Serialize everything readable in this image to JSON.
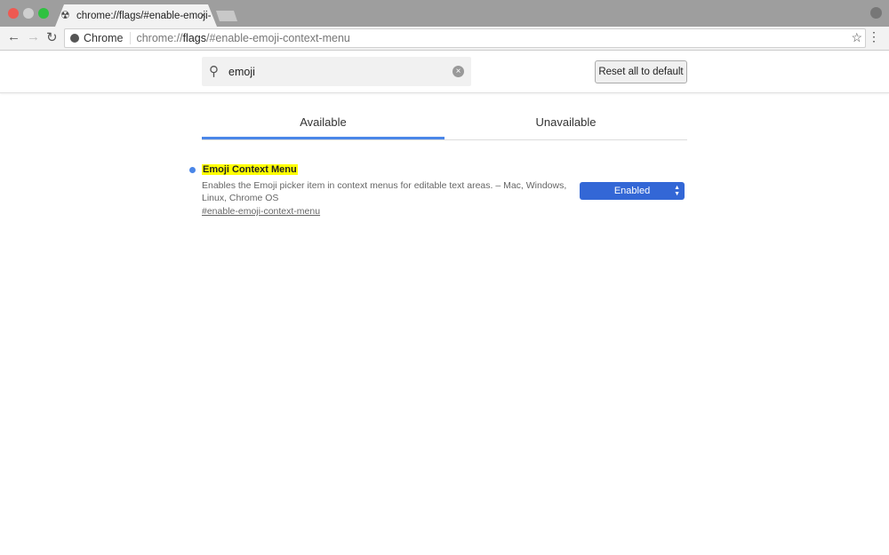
{
  "window": {
    "colors": {
      "close": "#ee5a52",
      "minimize": "#cfcfcf",
      "maximize": "#2fc141"
    }
  },
  "tab": {
    "title": "chrome://flags/#enable-emoji-",
    "favicon": "flags-icon"
  },
  "toolbar": {
    "chip": "Chrome",
    "url_prefix": "chrome://",
    "url_bold": "flags",
    "url_suffix": "/#enable-emoji-context-menu"
  },
  "header": {
    "search_value": "emoji",
    "reset_label": "Reset all to default"
  },
  "tabs": [
    {
      "label": "Available",
      "active": true
    },
    {
      "label": "Unavailable",
      "active": false
    }
  ],
  "flag": {
    "title": "Emoji Context Menu",
    "description": "Enables the Emoji picker item in context menus for editable text areas. – Mac, Windows, Linux, Chrome OS",
    "link": "#enable-emoji-context-menu",
    "state": "Enabled",
    "accent": "#3367d6"
  }
}
